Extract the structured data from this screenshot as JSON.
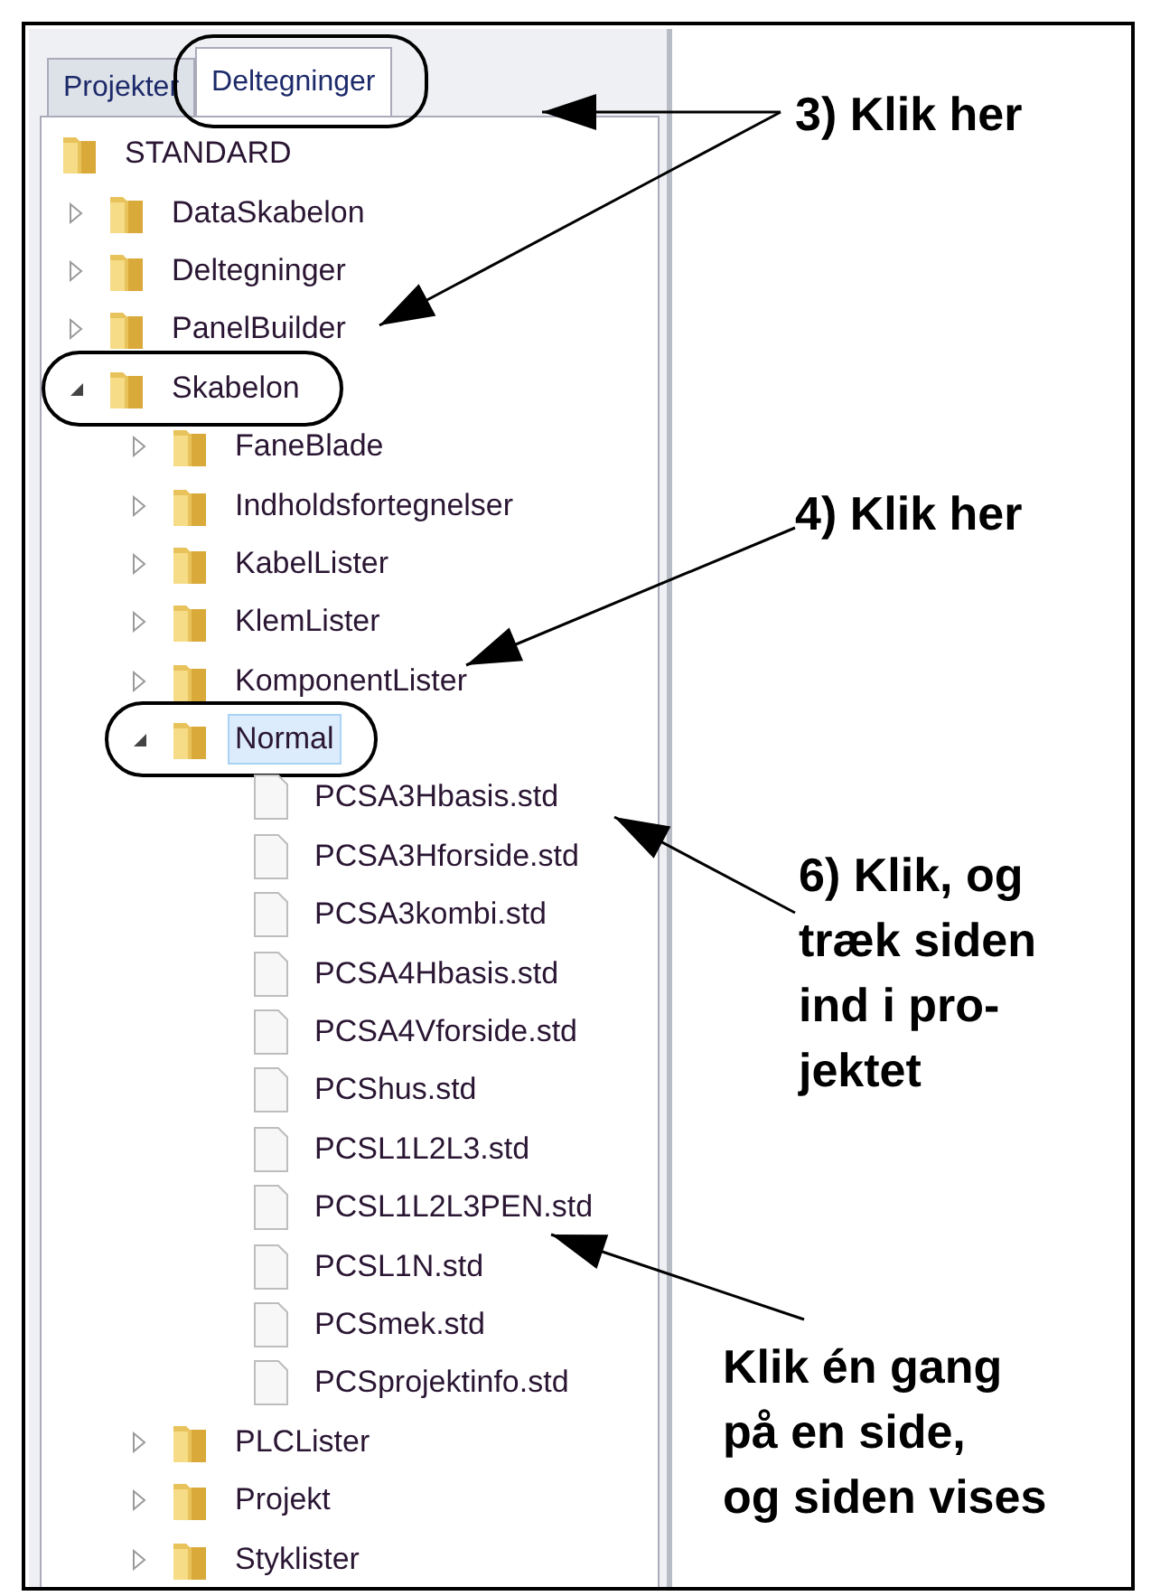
{
  "tabs": [
    {
      "label": "Projekter",
      "selected": false,
      "circled": false
    },
    {
      "label": "Deltegninger",
      "selected": true,
      "circled": true
    }
  ],
  "tree": [
    {
      "kind": "folder",
      "label": "STANDARD",
      "selected": false,
      "circled": false,
      "children": [
        {
          "kind": "folder",
          "label": "DataSkabelon",
          "expanded": false,
          "selected": false,
          "circled": false
        },
        {
          "kind": "folder",
          "label": "Deltegninger",
          "expanded": false,
          "selected": false,
          "circled": false
        },
        {
          "kind": "folder",
          "label": "PanelBuilder",
          "expanded": false,
          "selected": false,
          "circled": false
        },
        {
          "kind": "folder",
          "label": "Skabelon",
          "expanded": true,
          "selected": false,
          "circled": true,
          "children": [
            {
              "kind": "folder",
              "label": "FaneBlade",
              "expanded": false,
              "selected": false,
              "circled": false
            },
            {
              "kind": "folder",
              "label": "Indholdsfortegnelser",
              "expanded": false,
              "selected": false,
              "circled": false
            },
            {
              "kind": "folder",
              "label": "KabelLister",
              "expanded": false,
              "selected": false,
              "circled": false
            },
            {
              "kind": "folder",
              "label": "KlemLister",
              "expanded": false,
              "selected": false,
              "circled": false
            },
            {
              "kind": "folder",
              "label": "KomponentLister",
              "expanded": false,
              "selected": false,
              "circled": false
            },
            {
              "kind": "folder",
              "label": "Normal",
              "expanded": true,
              "selected": true,
              "circled": true,
              "children": [
                {
                  "kind": "file",
                  "label": "PCSA3Hbasis.std",
                  "selected": false,
                  "circled": false
                },
                {
                  "kind": "file",
                  "label": "PCSA3Hforside.std",
                  "selected": false,
                  "circled": false
                },
                {
                  "kind": "file",
                  "label": "PCSA3kombi.std",
                  "selected": false,
                  "circled": false
                },
                {
                  "kind": "file",
                  "label": "PCSA4Hbasis.std",
                  "selected": false,
                  "circled": false
                },
                {
                  "kind": "file",
                  "label": "PCSA4Vforside.std",
                  "selected": false,
                  "circled": false
                },
                {
                  "kind": "file",
                  "label": "PCShus.std",
                  "selected": false,
                  "circled": false
                },
                {
                  "kind": "file",
                  "label": "PCSL1L2L3.std",
                  "selected": false,
                  "circled": false
                },
                {
                  "kind": "file",
                  "label": "PCSL1L2L3PEN.std",
                  "selected": false,
                  "circled": false
                },
                {
                  "kind": "file",
                  "label": "PCSL1N.std",
                  "selected": false,
                  "circled": false
                },
                {
                  "kind": "file",
                  "label": "PCSmek.std",
                  "selected": false,
                  "circled": false
                },
                {
                  "kind": "file",
                  "label": "PCSprojektinfo.std",
                  "selected": false,
                  "circled": false
                }
              ]
            },
            {
              "kind": "folder",
              "label": "PLCLister",
              "expanded": false,
              "selected": false,
              "circled": false
            },
            {
              "kind": "folder",
              "label": "Projekt",
              "expanded": false,
              "selected": false,
              "circled": false
            },
            {
              "kind": "folder",
              "label": "Styklister",
              "expanded": false,
              "selected": false,
              "circled": false
            }
          ]
        }
      ]
    }
  ],
  "annotations": [
    {
      "lines": [
        "3) Klik her"
      ]
    },
    {
      "lines": [
        "4) Klik her"
      ]
    },
    {
      "lines": [
        "6) Klik, og",
        "træk siden",
        "ind i pro-",
        "jektet"
      ]
    },
    {
      "lines": [
        "Klik én gang",
        "på en side,",
        "og siden vises"
      ]
    }
  ]
}
